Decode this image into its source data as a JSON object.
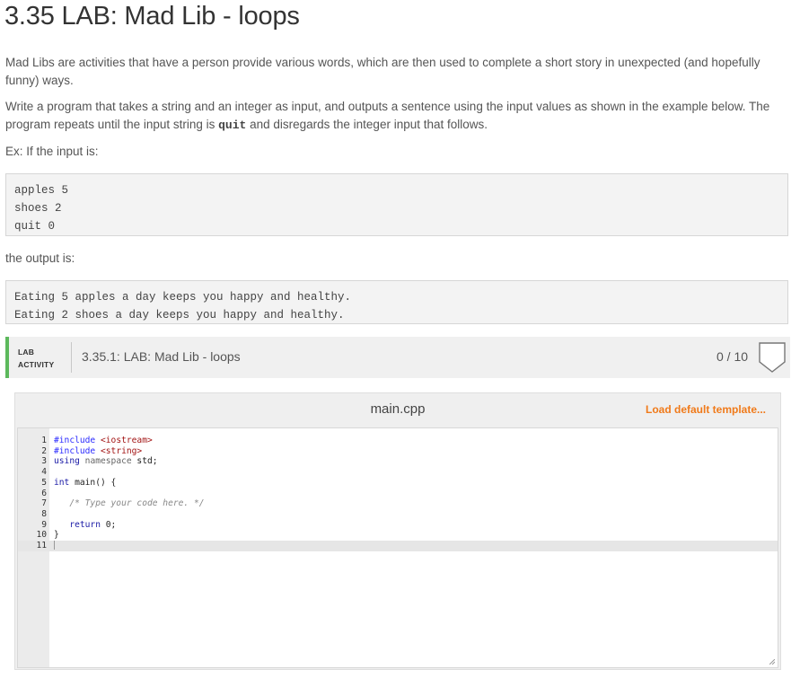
{
  "page": {
    "title": "3.35 LAB: Mad Lib - loops"
  },
  "description": {
    "para1": "Mad Libs are activities that have a person provide various words, which are then used to complete a short story in unexpected (and hopefully funny) ways.",
    "para2_before": "Write a program that takes a string and an integer as input, and outputs a sentence using the input values as shown in the example below. The program repeats until the input string is ",
    "para2_code": "quit",
    "para2_after": " and disregards the integer input that follows.",
    "example_intro": "Ex: If the input is:",
    "output_intro": "the output is:"
  },
  "example_input": [
    "apples 5",
    "shoes 2",
    "quit 0"
  ],
  "example_output": [
    "Eating 5 apples a day keeps you happy and healthy.",
    "Eating 2 shoes a day keeps you happy and healthy."
  ],
  "lab": {
    "label_line1": "LAB",
    "label_line2": "ACTIVITY",
    "title": "3.35.1: LAB: Mad Lib - loops",
    "score": "0 / 10",
    "accent_color": "#5cb85c"
  },
  "editor": {
    "file_name": "main.cpp",
    "load_template_label": "Load default template...",
    "load_template_color": "#f07a1a",
    "line_numbers": [
      "1",
      "2",
      "3",
      "4",
      "5",
      "6",
      "7",
      "8",
      "9",
      "10",
      "11"
    ],
    "code": {
      "l1_kw": "#include",
      "l1_str": "<iostream>",
      "l2_kw": "#include",
      "l2_str": "<string>",
      "l3_kw": "using",
      "l3_ns": "namespace",
      "l3_rest": " std;",
      "l5_type": "int",
      "l5_rest": " main() {",
      "l7_comment": "/* Type your code here. */",
      "l9_kw": "return",
      "l9_rest": " 0;",
      "l10": "}"
    }
  }
}
